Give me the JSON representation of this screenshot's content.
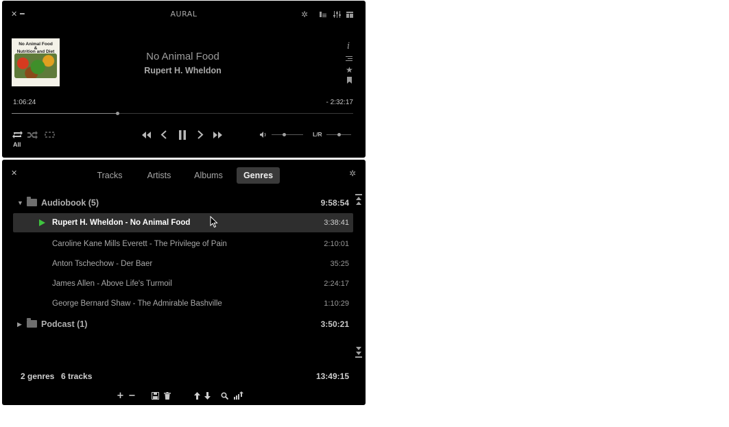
{
  "app": {
    "title": "AURAL"
  },
  "now_playing": {
    "title": "No Animal Food",
    "artist": "Rupert H. Wheldon",
    "elapsed": "1:06:24",
    "remaining": "- 2:32:17",
    "progress": 0.31,
    "cover": {
      "line1": "No Animal Food",
      "line2": "&",
      "line3": "Nutrition and Diet"
    }
  },
  "controls": {
    "repeat_label": "All",
    "volume": 0.4,
    "balance_label": "L/R",
    "balance": 0.5
  },
  "playlist": {
    "tabs": [
      {
        "label": "Tracks"
      },
      {
        "label": "Artists"
      },
      {
        "label": "Albums"
      },
      {
        "label": "Genres"
      }
    ],
    "active_tab": "Genres",
    "groups": [
      {
        "name": "Audiobook (5)",
        "duration": "9:58:54",
        "expanded": true,
        "tracks": [
          {
            "name": "Rupert H. Wheldon - No Animal Food",
            "duration": "3:38:41",
            "playing": true
          },
          {
            "name": "Caroline Kane Mills Everett - The Privilege of Pain",
            "duration": "2:10:01"
          },
          {
            "name": "Anton Tschechow - Der Baer",
            "duration": "35:25"
          },
          {
            "name": "James Allen - Above Life's Turmoil",
            "duration": "2:24:17"
          },
          {
            "name": "George Bernard Shaw - The Admirable Bashville",
            "duration": "1:10:29"
          }
        ]
      },
      {
        "name": "Podcast (1)",
        "duration": "3:50:21",
        "expanded": false,
        "tracks": []
      }
    ],
    "summary": {
      "genres": "2 genres",
      "tracks": "6 tracks",
      "total": "13:49:15"
    }
  },
  "colors": {
    "background": "#000000",
    "playing_indicator": "#3fc43f",
    "selected_row": "#2e2e2e"
  }
}
